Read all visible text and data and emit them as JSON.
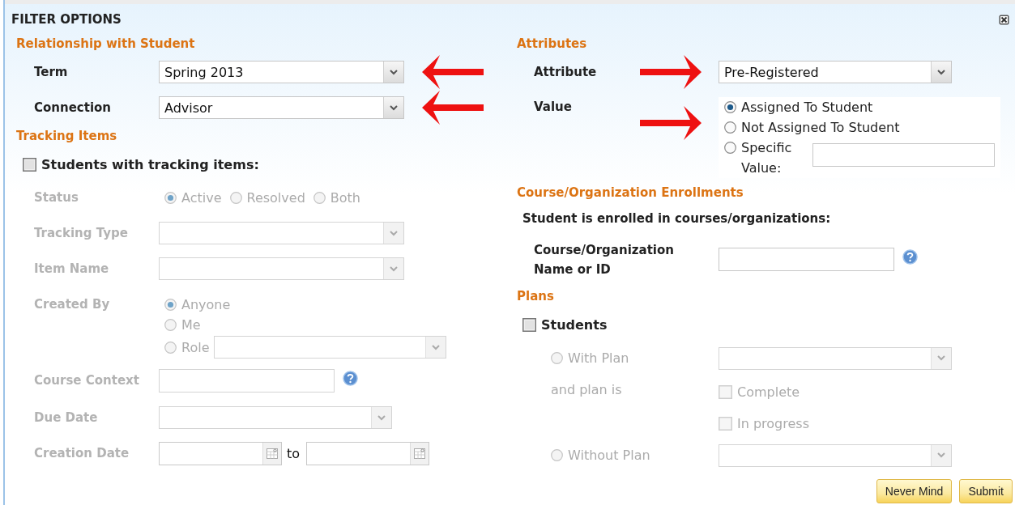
{
  "dialog": {
    "title": "FILTER OPTIONS"
  },
  "relationship": {
    "heading": "Relationship with Student",
    "fields": [
      {
        "label": "Term",
        "value": "Spring 2013",
        "arrow_marked": true
      },
      {
        "label": "Connection",
        "value": "Advisor",
        "arrow_marked": true
      }
    ]
  },
  "tracking_items": {
    "heading": "Tracking Items",
    "toggle": {
      "label": "Students with tracking items:",
      "checked": false
    },
    "disabled": true,
    "rows": [
      {
        "kind": "radios",
        "label": "Status",
        "options": [
          {
            "label": "Active",
            "selected": true
          },
          {
            "label": "Resolved",
            "selected": false
          },
          {
            "label": "Both",
            "selected": false
          }
        ]
      },
      {
        "kind": "select",
        "label": "Tracking Type"
      },
      {
        "kind": "select",
        "label": "Item Name"
      },
      {
        "kind": "stacked_radios",
        "label": "Created By",
        "options": [
          {
            "label": "Anyone",
            "selected": true,
            "has_select": false
          },
          {
            "label": "Me",
            "selected": false,
            "has_select": false
          },
          {
            "label": "Role",
            "selected": false,
            "has_select": true
          }
        ]
      },
      {
        "kind": "help_field",
        "label": "Course Context"
      },
      {
        "kind": "short_select",
        "label": "Due Date"
      },
      {
        "kind": "date_range",
        "label": "Creation Date",
        "separator": "to"
      }
    ]
  },
  "attributes": {
    "heading": "Attributes",
    "attribute": {
      "label": "Attribute",
      "value": "Pre-Registered",
      "arrow_marked": true
    },
    "value": {
      "label": "Value",
      "arrow_marked": true,
      "options": [
        {
          "label": "Assigned To Student",
          "selected": true,
          "has_input": false
        },
        {
          "label": "Not Assigned To Student",
          "selected": false,
          "has_input": false
        },
        {
          "label": "Specific Value:",
          "selected": false,
          "has_input": true
        }
      ]
    }
  },
  "enrollments": {
    "heading": "Course/Organization Enrollments",
    "prompt": "Student is enrolled in courses/organizations:",
    "field_label": "Course/Organization Name or ID"
  },
  "plans": {
    "heading": "Plans",
    "toggle": {
      "label": "Students",
      "checked": false
    },
    "disabled": true,
    "with_plan": {
      "label": "With Plan",
      "selected": false
    },
    "status_label": "and plan is",
    "statuses": [
      {
        "label": "Complete",
        "checked": false
      },
      {
        "label": "In progress",
        "checked": false
      }
    ],
    "without_plan": {
      "label": "Without Plan",
      "selected": false
    }
  },
  "buttons": [
    {
      "label": "Never Mind"
    },
    {
      "label": "Submit"
    }
  ]
}
